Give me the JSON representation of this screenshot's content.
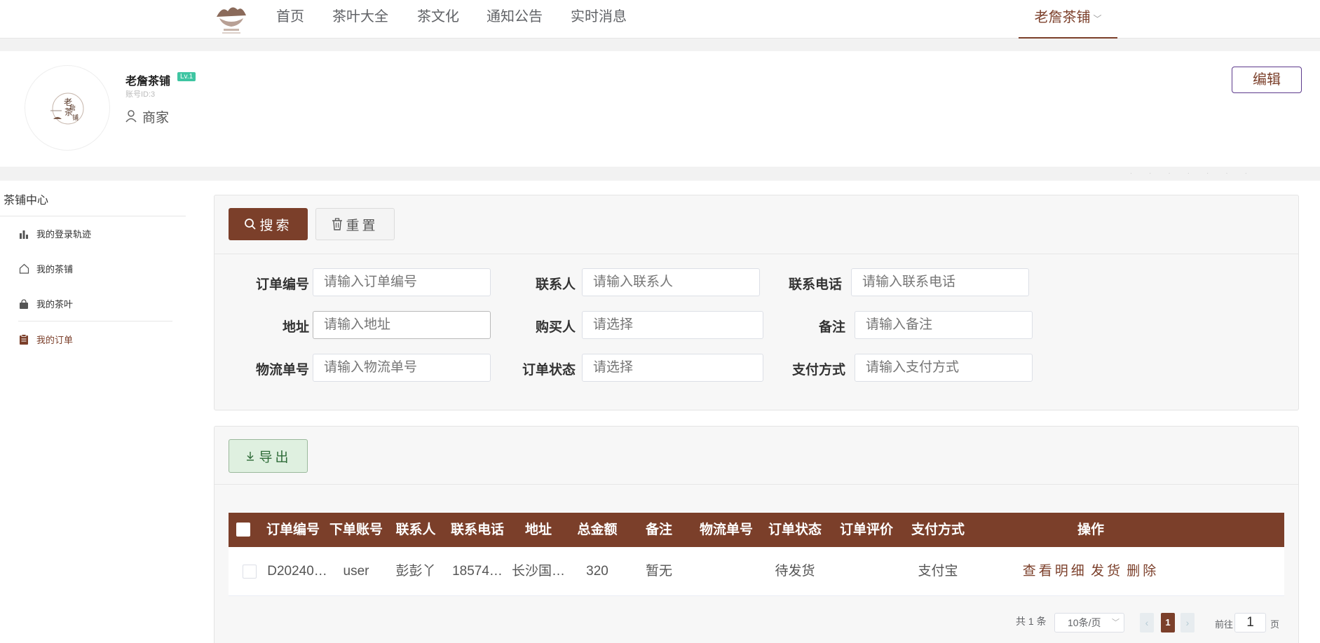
{
  "nav": {
    "items": [
      "首页",
      "茶叶大全",
      "茶文化",
      "通知公告",
      "实时消息"
    ],
    "user": "老詹茶铺"
  },
  "profile": {
    "name": "老詹茶铺",
    "level": "Lv.1",
    "account_id": "账号ID:3",
    "role": "商家",
    "edit_label": "编辑"
  },
  "sidebar": {
    "title": "茶铺中心",
    "items": [
      {
        "label": "我的登录轨迹",
        "icon": "bar-chart-icon"
      },
      {
        "label": "我的茶铺",
        "icon": "home-icon"
      },
      {
        "label": "我的茶叶",
        "icon": "bag-icon"
      },
      {
        "label": "我的订单",
        "icon": "clipboard-icon"
      }
    ],
    "active_index": 3
  },
  "search": {
    "search_label": "搜索",
    "reset_label": "重置",
    "fields": [
      {
        "label": "订单编号",
        "placeholder": "请输入订单编号"
      },
      {
        "label": "联系人",
        "placeholder": "请输入联系人"
      },
      {
        "label": "联系电话",
        "placeholder": "请输入联系电话"
      },
      {
        "label": "地址",
        "placeholder": "请输入地址"
      },
      {
        "label": "购买人",
        "placeholder": "请选择"
      },
      {
        "label": "备注",
        "placeholder": "请输入备注"
      },
      {
        "label": "物流单号",
        "placeholder": "请输入物流单号"
      },
      {
        "label": "订单状态",
        "placeholder": "请选择"
      },
      {
        "label": "支付方式",
        "placeholder": "请输入支付方式"
      }
    ]
  },
  "table": {
    "export_label": "导出",
    "columns": [
      "订单编号",
      "下单账号",
      "联系人",
      "联系电话",
      "地址",
      "总金额",
      "备注",
      "物流单号",
      "订单状态",
      "订单评价",
      "支付方式",
      "操作"
    ],
    "rows": [
      {
        "order_no": "D20240…",
        "account": "user",
        "contact": "彭彭丫",
        "phone": "18574…",
        "address": "长沙国…",
        "total": "320",
        "remark": "暂无",
        "logistics_no": "",
        "status": "待发货",
        "review": "",
        "pay_method": "支付宝",
        "actions": [
          "查看明细",
          "发货",
          "删除"
        ]
      }
    ]
  },
  "pagination": {
    "total_text": "共 1 条",
    "page_size": "10条/页",
    "current": "1",
    "goto_prefix": "前往",
    "goto_value": "1",
    "goto_suffix": "页"
  },
  "colors": {
    "brand": "#7b3f2a",
    "level_badge": "#3fc5a2",
    "export_bg": "#dff0e0"
  }
}
